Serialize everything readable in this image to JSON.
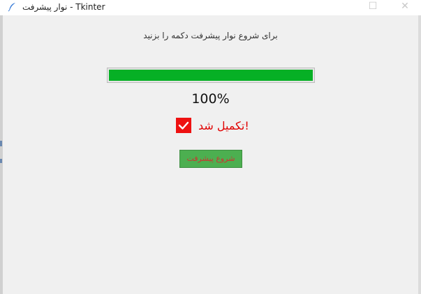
{
  "window": {
    "title": "نوار پیشرفت - Tkinter",
    "app_icon": "feather-icon",
    "maximize_symbol": "☐",
    "close_symbol": "✕"
  },
  "instruction_text": "برای شروع نوار پیشرفت دکمه را بزنید",
  "progress": {
    "value": 100,
    "max": 100,
    "percent_label": "100%",
    "fill_color": "#06b025"
  },
  "status": {
    "icon": "check-icon",
    "icon_bg_color": "#ee1111",
    "text": "!تکمیل شد",
    "text_color": "#e00000"
  },
  "start_button": {
    "label": "شروع پیشرفت",
    "bg_color": "#4caf50"
  }
}
